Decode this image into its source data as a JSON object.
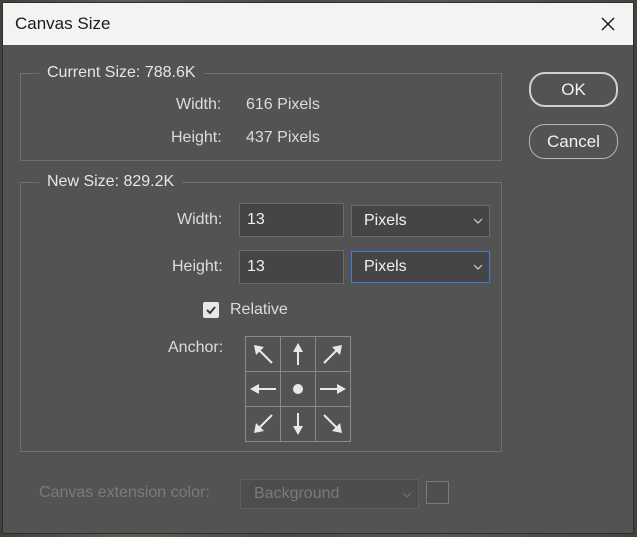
{
  "window": {
    "title": "Canvas Size",
    "close_icon": "close-icon"
  },
  "current_size": {
    "legend": "Current Size: 788.6K",
    "width_label": "Width:",
    "width_value": "616 Pixels",
    "height_label": "Height:",
    "height_value": "437 Pixels"
  },
  "new_size": {
    "legend": "New Size: 829.2K",
    "width_label": "Width:",
    "width_value": "13",
    "width_unit": "Pixels",
    "height_label": "Height:",
    "height_value": "13",
    "height_unit": "Pixels",
    "relative_label": "Relative",
    "relative_checked": true,
    "anchor_label": "Anchor:",
    "anchor_icons": [
      "arrow-nw-icon",
      "arrow-n-icon",
      "arrow-ne-icon",
      "arrow-w-icon",
      "anchor-center-icon",
      "arrow-e-icon",
      "arrow-sw-icon",
      "arrow-s-icon",
      "arrow-se-icon"
    ]
  },
  "buttons": {
    "ok": "OK",
    "cancel": "Cancel"
  },
  "extension": {
    "label": "Canvas extension color:",
    "value": "Background"
  },
  "colors": {
    "dialog_bg": "#535353",
    "titlebar_bg": "#f3f3f3",
    "focus_border": "#3b7fd8",
    "text": "#dcdcdc"
  }
}
